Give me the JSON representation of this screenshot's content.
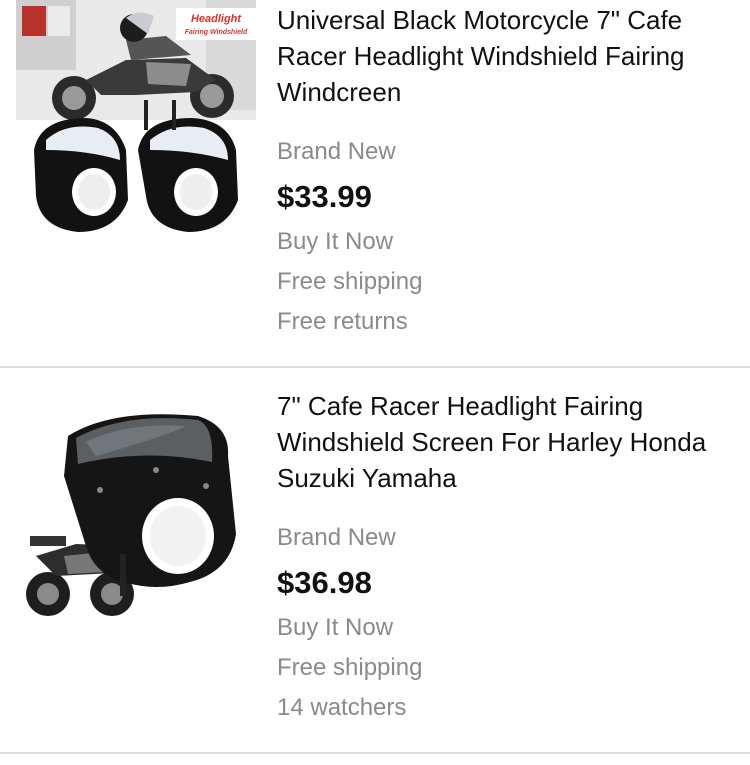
{
  "listings": [
    {
      "title": "Universal Black Motorcycle 7\" Cafe Racer Headlight Windshield Fairing Windcreen",
      "condition": "Brand New",
      "price": "$33.99",
      "format": "Buy It Now",
      "shipping": "Free shipping",
      "extra": "Free returns",
      "image_banner": {
        "line1": "Headlight",
        "line2": "Fairing Windshield"
      }
    },
    {
      "title": "7\" Cafe Racer Headlight Fairing Windshield Screen For Harley Honda Suzuki Yamaha",
      "condition": "Brand New",
      "price": "$36.98",
      "format": "Buy It Now",
      "shipping": "Free shipping",
      "extra": "14 watchers"
    }
  ],
  "colors": {
    "title": "#111111",
    "secondary": "#8a8a8a",
    "divider": "#dcdcdc",
    "banner_red": "#d9342b"
  }
}
